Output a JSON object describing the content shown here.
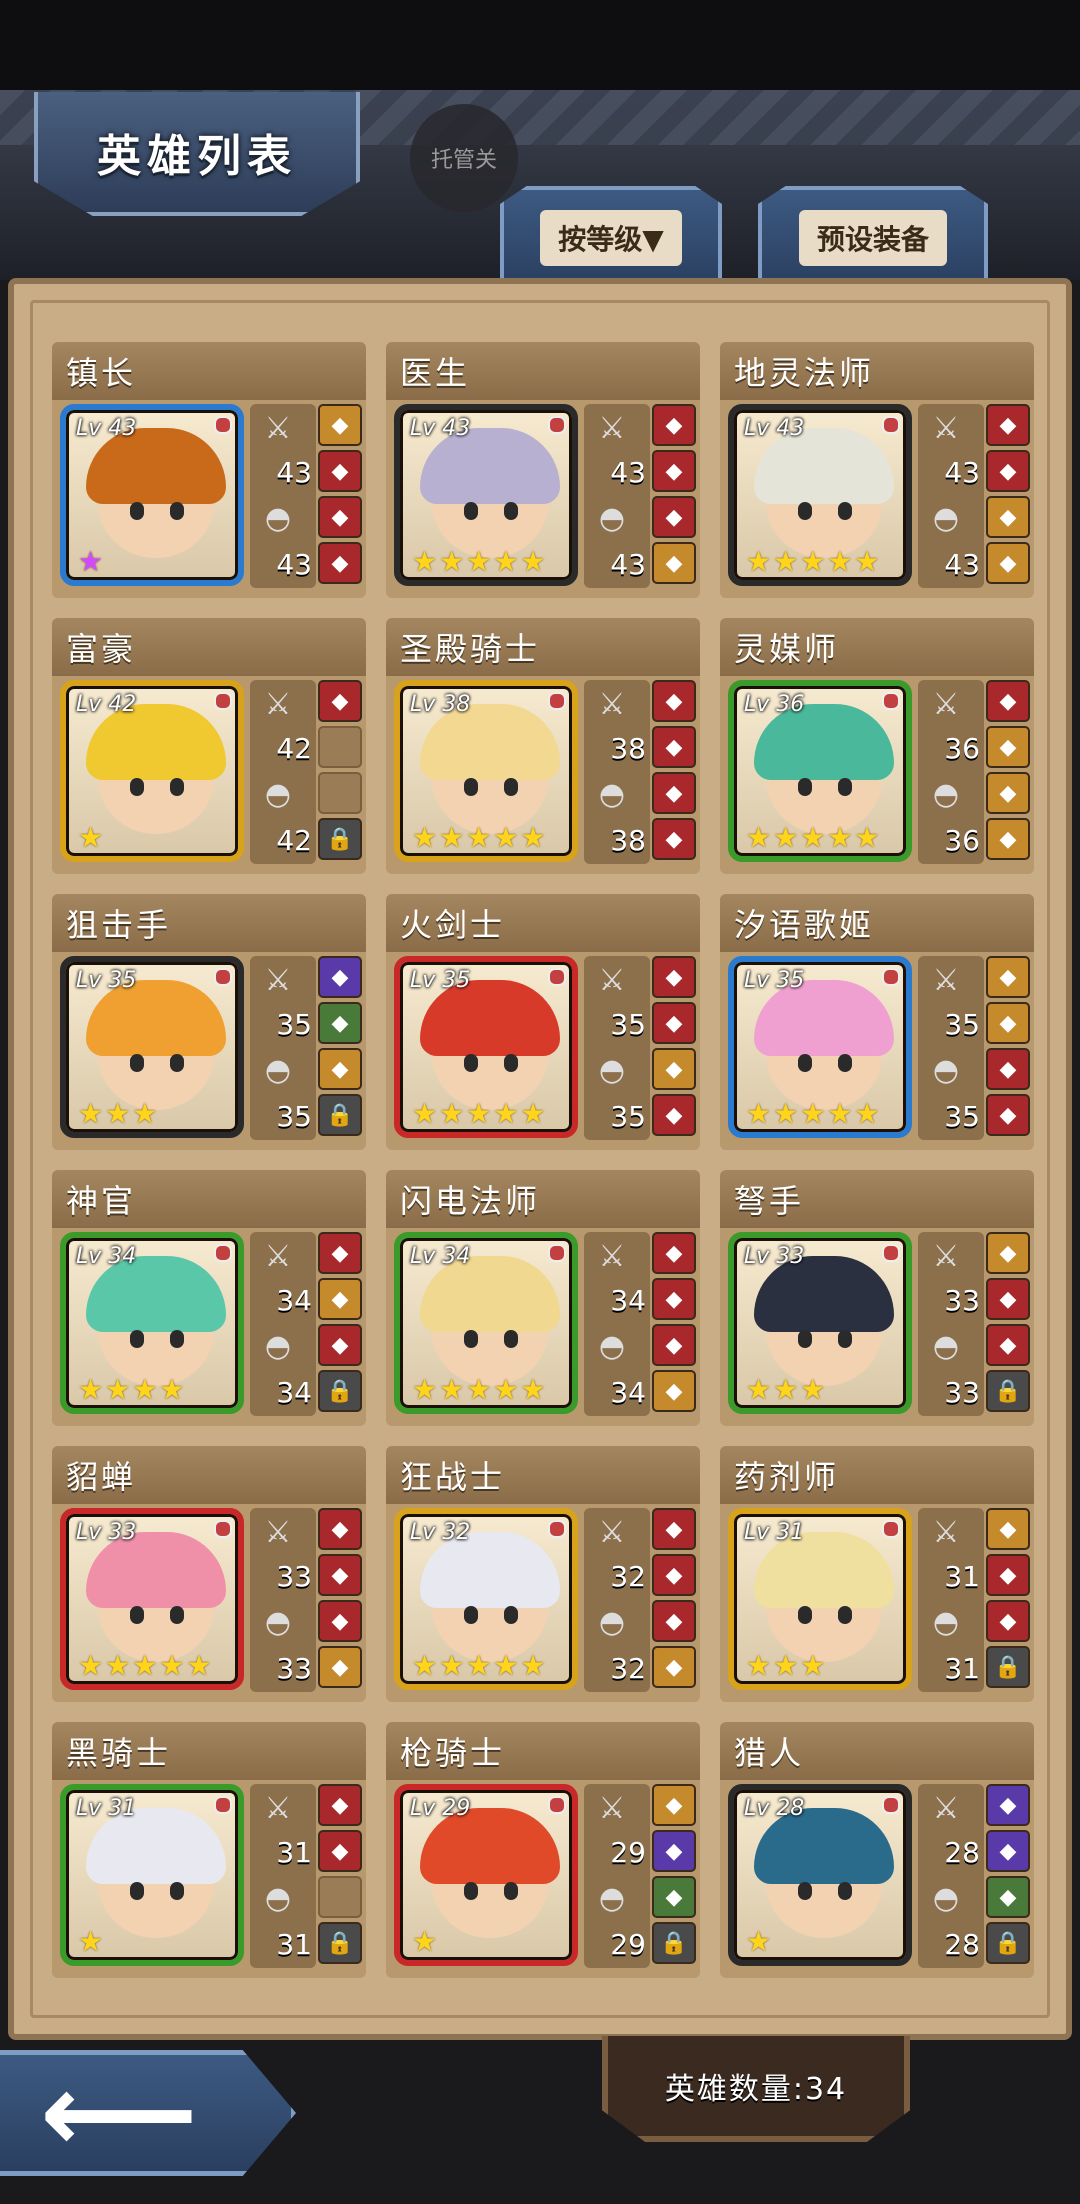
{
  "header": {
    "title": "英雄列表",
    "auto_button": "托管关",
    "sort_tab": "按等级▼",
    "preset_tab": "预设装备"
  },
  "footer": {
    "hero_count_label": "英雄数量:34",
    "back_icon": "left-arrow-icon"
  },
  "heroes": [
    {
      "name": "镇长",
      "level": "Lv 43",
      "attack": "43",
      "defense": "43",
      "stars": 1,
      "star_color": "purple",
      "frame_color": "#2a7ad0",
      "hair_color": "#c86a1a",
      "slots": [
        "gold",
        "red",
        "red",
        "red"
      ]
    },
    {
      "name": "医生",
      "level": "Lv 43",
      "attack": "43",
      "defense": "43",
      "stars": 5,
      "star_color": "gold",
      "frame_color": "#2a2a2a",
      "hair_color": "#b8b0d0",
      "slots": [
        "red",
        "red",
        "red",
        "gold"
      ]
    },
    {
      "name": "地灵法师",
      "level": "Lv 43",
      "attack": "43",
      "defense": "43",
      "stars": 5,
      "star_color": "gold",
      "frame_color": "#2a2a2a",
      "hair_color": "#e4e4d8",
      "slots": [
        "red",
        "red",
        "gold",
        "gold"
      ]
    },
    {
      "name": "富豪",
      "level": "Lv 42",
      "attack": "42",
      "defense": "42",
      "stars": 1,
      "star_color": "gold",
      "frame_color": "#d8a21a",
      "hair_color": "#f0c830",
      "slots": [
        "red",
        "empty",
        "empty",
        "locked"
      ]
    },
    {
      "name": "圣殿骑士",
      "level": "Lv 38",
      "attack": "38",
      "defense": "38",
      "stars": 5,
      "star_color": "gold",
      "frame_color": "#d8a21a",
      "hair_color": "#f2d890",
      "slots": [
        "red",
        "red",
        "red",
        "red"
      ]
    },
    {
      "name": "灵媒师",
      "level": "Lv 36",
      "attack": "36",
      "defense": "36",
      "stars": 5,
      "star_color": "gold",
      "frame_color": "#3a9a2a",
      "hair_color": "#4ab89a",
      "slots": [
        "red",
        "gold",
        "gold",
        "gold"
      ]
    },
    {
      "name": "狙击手",
      "level": "Lv 35",
      "attack": "35",
      "defense": "35",
      "stars": 3,
      "star_color": "gold",
      "frame_color": "#2a2a2a",
      "hair_color": "#f0a030",
      "slots": [
        "purple",
        "green",
        "gold",
        "locked"
      ]
    },
    {
      "name": "火剑士",
      "level": "Lv 35",
      "attack": "35",
      "defense": "35",
      "stars": 5,
      "star_color": "gold",
      "frame_color": "#c82828",
      "hair_color": "#d83a2a",
      "slots": [
        "red",
        "red",
        "gold",
        "red"
      ]
    },
    {
      "name": "汐语歌姬",
      "level": "Lv 35",
      "attack": "35",
      "defense": "35",
      "stars": 5,
      "star_color": "gold",
      "frame_color": "#2a7ad0",
      "hair_color": "#f0a0d0",
      "slots": [
        "gold",
        "gold",
        "red",
        "red"
      ]
    },
    {
      "name": "神官",
      "level": "Lv 34",
      "attack": "34",
      "defense": "34",
      "stars": 4,
      "star_color": "gold",
      "frame_color": "#3a9a2a",
      "hair_color": "#5ac8a8",
      "slots": [
        "red",
        "gold",
        "red",
        "locked"
      ]
    },
    {
      "name": "闪电法师",
      "level": "Lv 34",
      "attack": "34",
      "defense": "34",
      "stars": 5,
      "star_color": "gold",
      "frame_color": "#3a9a2a",
      "hair_color": "#f0d890",
      "slots": [
        "red",
        "red",
        "red",
        "gold"
      ]
    },
    {
      "name": "弩手",
      "level": "Lv 33",
      "attack": "33",
      "defense": "33",
      "stars": 3,
      "star_color": "gold",
      "frame_color": "#3a9a2a",
      "hair_color": "#2a3040",
      "slots": [
        "gold",
        "red",
        "red",
        "locked"
      ]
    },
    {
      "name": "貂蝉",
      "level": "Lv 33",
      "attack": "33",
      "defense": "33",
      "stars": 5,
      "star_color": "gold",
      "frame_color": "#c82828",
      "hair_color": "#f090a8",
      "slots": [
        "red",
        "red",
        "red",
        "gold"
      ]
    },
    {
      "name": "狂战士",
      "level": "Lv 32",
      "attack": "32",
      "defense": "32",
      "stars": 5,
      "star_color": "gold",
      "frame_color": "#d8a21a",
      "hair_color": "#e8e8f0",
      "slots": [
        "red",
        "red",
        "red",
        "gold"
      ]
    },
    {
      "name": "药剂师",
      "level": "Lv 31",
      "attack": "31",
      "defense": "31",
      "stars": 3,
      "star_color": "gold",
      "frame_color": "#d8a21a",
      "hair_color": "#f0e0a0",
      "slots": [
        "gold",
        "red",
        "red",
        "locked"
      ]
    },
    {
      "name": "黑骑士",
      "level": "Lv 31",
      "attack": "31",
      "defense": "31",
      "stars": 1,
      "star_color": "gold",
      "frame_color": "#3a9a2a",
      "hair_color": "#e8e8f0",
      "slots": [
        "red",
        "red",
        "empty",
        "locked"
      ]
    },
    {
      "name": "枪骑士",
      "level": "Lv 29",
      "attack": "29",
      "defense": "29",
      "stars": 1,
      "star_color": "gold",
      "frame_color": "#c82828",
      "hair_color": "#e04a28",
      "slots": [
        "gold",
        "purple",
        "green",
        "locked"
      ]
    },
    {
      "name": "猎人",
      "level": "Lv 28",
      "attack": "28",
      "defense": "28",
      "stars": 1,
      "star_color": "gold",
      "frame_color": "#2a2a2a",
      "hair_color": "#2a6a8a",
      "slots": [
        "purple",
        "purple",
        "green",
        "locked"
      ]
    }
  ]
}
